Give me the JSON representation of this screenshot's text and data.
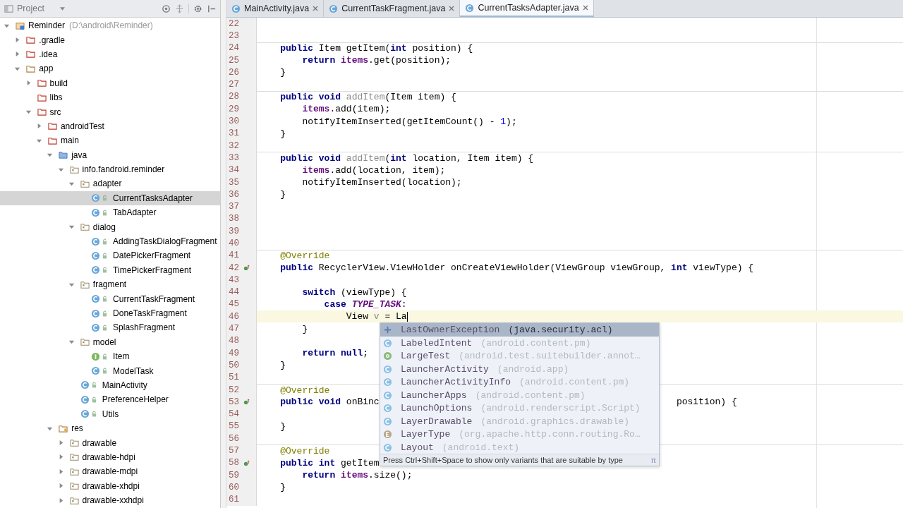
{
  "project": {
    "title": "Project",
    "tree": [
      {
        "kind": "module",
        "label": "Reminder",
        "hint": "(D:\\android\\Reminder)",
        "expanded": true,
        "selected": false,
        "children": [
          {
            "kind": "folder",
            "label": ".gradle",
            "expanded": false,
            "selected": false
          },
          {
            "kind": "folder",
            "label": ".idea",
            "expanded": false,
            "selected": false
          },
          {
            "kind": "module-folder",
            "label": "app",
            "expanded": true,
            "selected": false,
            "children": [
              {
                "kind": "folder",
                "label": "build",
                "expanded": false,
                "selected": false
              },
              {
                "kind": "folder",
                "label": "libs",
                "selected": false
              },
              {
                "kind": "folder",
                "label": "src",
                "expanded": true,
                "selected": false,
                "children": [
                  {
                    "kind": "folder",
                    "label": "androidTest",
                    "expanded": false,
                    "selected": false
                  },
                  {
                    "kind": "folder",
                    "label": "main",
                    "expanded": true,
                    "selected": false,
                    "children": [
                      {
                        "kind": "source-folder",
                        "label": "java",
                        "expanded": true,
                        "selected": false,
                        "children": [
                          {
                            "kind": "package",
                            "label": "info.fandroid.reminder",
                            "expanded": true,
                            "selected": false,
                            "children": [
                              {
                                "kind": "package",
                                "label": "adapter",
                                "expanded": true,
                                "selected": false,
                                "children": [
                                  {
                                    "kind": "class",
                                    "label": "CurrentTasksAdapter",
                                    "selected": true
                                  },
                                  {
                                    "kind": "class",
                                    "label": "TabAdapter",
                                    "selected": false
                                  }
                                ]
                              },
                              {
                                "kind": "package",
                                "label": "dialog",
                                "expanded": true,
                                "selected": false,
                                "children": [
                                  {
                                    "kind": "class",
                                    "label": "AddingTaskDialogFragment",
                                    "selected": false
                                  },
                                  {
                                    "kind": "class",
                                    "label": "DatePickerFragment",
                                    "selected": false
                                  },
                                  {
                                    "kind": "class",
                                    "label": "TimePickerFragment",
                                    "selected": false
                                  }
                                ]
                              },
                              {
                                "kind": "package",
                                "label": "fragment",
                                "expanded": true,
                                "selected": false,
                                "children": [
                                  {
                                    "kind": "class",
                                    "label": "CurrentTaskFragment",
                                    "selected": false
                                  },
                                  {
                                    "kind": "class",
                                    "label": "DoneTaskFragment",
                                    "selected": false
                                  },
                                  {
                                    "kind": "class",
                                    "label": "SplashFragment",
                                    "selected": false
                                  }
                                ]
                              },
                              {
                                "kind": "package",
                                "label": "model",
                                "expanded": true,
                                "selected": false,
                                "children": [
                                  {
                                    "kind": "interface",
                                    "label": "Item",
                                    "selected": false
                                  },
                                  {
                                    "kind": "class",
                                    "label": "ModelTask",
                                    "selected": false
                                  }
                                ]
                              },
                              {
                                "kind": "class",
                                "label": "MainActivity",
                                "selected": false
                              },
                              {
                                "kind": "class",
                                "label": "PreferenceHelper",
                                "selected": false
                              },
                              {
                                "kind": "class",
                                "label": "Utils",
                                "selected": false
                              }
                            ]
                          }
                        ]
                      },
                      {
                        "kind": "res-folder",
                        "label": "res",
                        "expanded": true,
                        "selected": false,
                        "children": [
                          {
                            "kind": "package",
                            "label": "drawable",
                            "expanded": false,
                            "selected": false
                          },
                          {
                            "kind": "package",
                            "label": "drawable-hdpi",
                            "expanded": false,
                            "selected": false
                          },
                          {
                            "kind": "package",
                            "label": "drawable-mdpi",
                            "expanded": false,
                            "selected": false
                          },
                          {
                            "kind": "package",
                            "label": "drawable-xhdpi",
                            "expanded": false,
                            "selected": false
                          },
                          {
                            "kind": "package",
                            "label": "drawable-xxhdpi",
                            "expanded": false,
                            "selected": false
                          }
                        ]
                      }
                    ]
                  }
                ]
              }
            ]
          }
        ]
      }
    ]
  },
  "tabs": [
    {
      "label": "MainActivity.java",
      "selected": false
    },
    {
      "label": "CurrentTaskFragment.java",
      "selected": false
    },
    {
      "label": "CurrentTasksAdapter.java",
      "selected": true
    }
  ],
  "editor": {
    "lines": [
      {
        "no": "22"
      },
      {
        "no": "23"
      },
      {
        "no": "24",
        "separator": true,
        "code": [
          {
            "kw": "    public"
          },
          {
            "plain": " Item getItem("
          },
          {
            "kw": "int"
          },
          {
            "plain": " position) {"
          }
        ]
      },
      {
        "no": "25",
        "code": [
          {
            "kw": "        return "
          },
          {
            "field": "items"
          },
          {
            "plain": ".get(position);"
          }
        ]
      },
      {
        "no": "26",
        "code": [
          {
            "plain": "    }"
          }
        ]
      },
      {
        "no": "27"
      },
      {
        "no": "28",
        "separator": true,
        "code": [
          {
            "kw": "    public void "
          },
          {
            "unused": "addItem"
          },
          {
            "plain": "(Item item) {"
          }
        ]
      },
      {
        "no": "29",
        "code": [
          {
            "field": "        items"
          },
          {
            "plain": ".add(item);"
          }
        ]
      },
      {
        "no": "30",
        "code": [
          {
            "plain": "        notifyItemInserted(getItemCount() - "
          },
          {
            "num": "1"
          },
          {
            "plain": ");"
          }
        ]
      },
      {
        "no": "31",
        "code": [
          {
            "plain": "    }"
          }
        ]
      },
      {
        "no": "32"
      },
      {
        "no": "33",
        "separator": true,
        "code": [
          {
            "kw": "    public void "
          },
          {
            "unused": "addItem"
          },
          {
            "plain": "("
          },
          {
            "kw": "int"
          },
          {
            "plain": " location, Item item) {"
          }
        ]
      },
      {
        "no": "34",
        "code": [
          {
            "field": "        items"
          },
          {
            "plain": ".add(location, item);"
          }
        ]
      },
      {
        "no": "35",
        "code": [
          {
            "plain": "        notifyItemInserted(location);"
          }
        ]
      },
      {
        "no": "36",
        "code": [
          {
            "plain": "    }"
          }
        ]
      },
      {
        "no": "37"
      },
      {
        "no": "38"
      },
      {
        "no": "39"
      },
      {
        "no": "40"
      },
      {
        "no": "41",
        "separator": true,
        "code": [
          {
            "ann": "    @Override"
          }
        ]
      },
      {
        "no": "42",
        "override_marker": true,
        "code": [
          {
            "kw": "    public"
          },
          {
            "plain": " RecyclerView.ViewHolder onCreateViewHolder(ViewGroup viewGroup, "
          },
          {
            "kw": "int"
          },
          {
            "plain": " viewType) {"
          }
        ]
      },
      {
        "no": "43"
      },
      {
        "no": "44",
        "code": [
          {
            "kw": "        switch"
          },
          {
            "plain": " (viewType) {"
          }
        ]
      },
      {
        "no": "45",
        "code": [
          {
            "kw": "            case "
          },
          {
            "const": "TYPE_TASK"
          },
          {
            "plain": ":"
          }
        ]
      },
      {
        "no": "46",
        "current": true,
        "code": [
          {
            "plain": "                View "
          },
          {
            "unused": "v"
          },
          {
            "plain": " = La"
          }
        ]
      },
      {
        "no": "47",
        "code": [
          {
            "plain": "        }"
          }
        ]
      },
      {
        "no": "48"
      },
      {
        "no": "49",
        "code": [
          {
            "kw": "        return null"
          },
          {
            "plain": ";"
          }
        ]
      },
      {
        "no": "50",
        "code": [
          {
            "plain": "    }"
          }
        ]
      },
      {
        "no": "51"
      },
      {
        "no": "52",
        "separator": true,
        "code": [
          {
            "ann": "    @Override"
          }
        ]
      },
      {
        "no": "53",
        "override_marker": true,
        "code": [
          {
            "kw": "    public void"
          },
          {
            "plain": " onBinc"
          }
        ],
        "tail": "position) {"
      },
      {
        "no": "54"
      },
      {
        "no": "55",
        "code": [
          {
            "plain": "    }"
          }
        ]
      },
      {
        "no": "56"
      },
      {
        "no": "57",
        "separator": true,
        "code": [
          {
            "ann": "    @Override"
          }
        ]
      },
      {
        "no": "58",
        "override_marker": true,
        "code": [
          {
            "kw": "    public int"
          },
          {
            "plain": " getItem"
          }
        ]
      },
      {
        "no": "59",
        "code": [
          {
            "kw": "        return "
          },
          {
            "field": "items"
          },
          {
            "plain": ".size();"
          }
        ]
      },
      {
        "no": "60",
        "code": [
          {
            "plain": "    }"
          }
        ]
      },
      {
        "no": "61"
      }
    ]
  },
  "completion": {
    "items": [
      {
        "kind": "exception",
        "name": "LastOwnerException",
        "package": "(java.security.acl)",
        "selected": true
      },
      {
        "kind": "class",
        "name": "LabeledIntent",
        "package": "(android.content.pm)",
        "selected": false
      },
      {
        "kind": "annotation",
        "name": "LargeTest",
        "package": "(android.test.suitebuilder.annot…",
        "selected": false
      },
      {
        "kind": "class",
        "name": "LauncherActivity",
        "package": "(android.app)",
        "selected": false
      },
      {
        "kind": "class",
        "name": "LauncherActivityInfo",
        "package": "(android.content.pm)",
        "selected": false
      },
      {
        "kind": "class",
        "name": "LauncherApps",
        "package": "(android.content.pm)",
        "selected": false
      },
      {
        "kind": "class",
        "name": "LaunchOptions",
        "package": "(android.renderscript.Script)",
        "selected": false
      },
      {
        "kind": "class",
        "name": "LayerDrawable",
        "package": "(android.graphics.drawable)",
        "selected": false
      },
      {
        "kind": "enum",
        "name": "LayerType",
        "package": "(org.apache.http.conn.routing.Ro…",
        "selected": false
      },
      {
        "kind": "class",
        "name": "Layout",
        "package": "(android.text)",
        "selected": false
      }
    ],
    "hint": "Press Ctrl+Shift+Space to show only variants that are suitable by type",
    "corner": "π"
  }
}
